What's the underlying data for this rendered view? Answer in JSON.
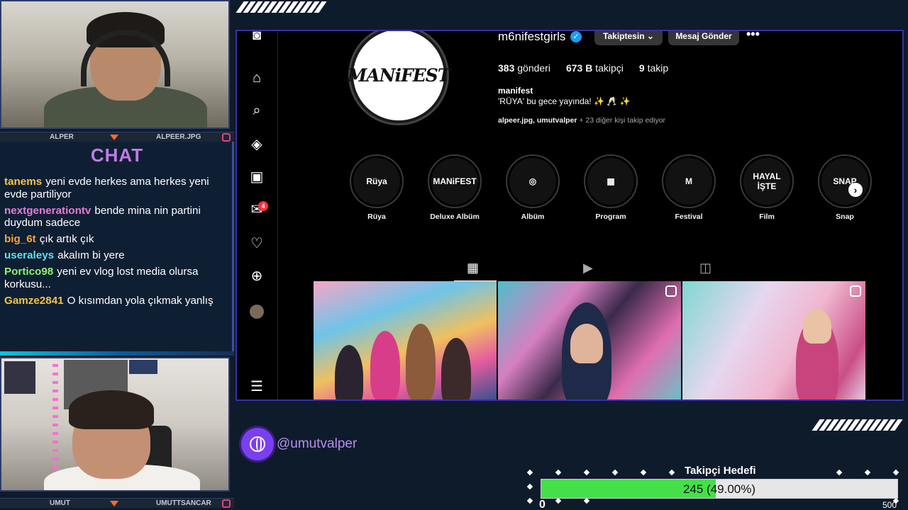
{
  "stream": {
    "cam_top": {
      "name_left": "ALPER",
      "name_right": "ALPEER.JPG"
    },
    "cam_bottom": {
      "name_left": "UMUT",
      "name_right": "UMUTTSANCAR"
    },
    "chat_title": "CHAT",
    "messages": [
      {
        "user": "tanems",
        "text": "yeni evde herkes ama herkes yeni evde partiliyor",
        "color": "#f6c34a"
      },
      {
        "user": "nextgenerationtv",
        "text": "bende mina nin partini duydum sadece",
        "color": "#e57bd8"
      },
      {
        "user": "big_6t",
        "text": "çık artık çık",
        "color": "#f6a13a"
      },
      {
        "user": "useraleys",
        "text": "akalım bi yere",
        "color": "#5ee0e8"
      },
      {
        "user": "Portico98",
        "text": "yeni ev vlog lost media olursa korkusu...",
        "color": "#8ef46a"
      },
      {
        "user": "Gamze2841",
        "text": "O kısımdan yola çıkmak yanlış",
        "color": "#f6c34a"
      }
    ],
    "handle": "@umutvalper",
    "goal": {
      "title": "Takipçi Hedefi",
      "current": 245,
      "max": 500,
      "min": 0,
      "label": "245 (49.00%)",
      "fraction": 0.49,
      "min_label": "0",
      "max_label": "500"
    }
  },
  "instagram": {
    "nav_icons": [
      "camera-icon",
      "home-icon",
      "search-icon",
      "explore-icon",
      "reels-icon",
      "messages-icon",
      "heart-icon",
      "create-icon",
      "profile-avatar",
      "menu-icon"
    ],
    "messages_badge": "4",
    "profile_pic_text": "MANiFEST",
    "username": "m6nifestgirls",
    "verified_mark": "✓",
    "follow_button": "Takiptesin ⌄",
    "message_button": "Mesaj Gönder",
    "more": "•••",
    "stats": {
      "posts_count": "383",
      "posts_label": "gönderi",
      "followers_count": "673 B",
      "followers_label": "takipçi",
      "following_count": "9",
      "following_label": "takip"
    },
    "bio_name": "manifest",
    "bio_text": "'RÜYA' bu gece yayında! ✨ 🥂 ✨",
    "followed_by_names": "alpeer.jpg, umutvalper",
    "followed_by_rest": " + 23 diğer kişi takip ediyor",
    "highlights": [
      {
        "label": "Rüya",
        "inner": "Rüya"
      },
      {
        "label": "Deluxe Albüm",
        "inner": "MANiFEST"
      },
      {
        "label": "Albüm",
        "inner": "◎"
      },
      {
        "label": "Program",
        "inner": "▦"
      },
      {
        "label": "Festival",
        "inner": "M"
      },
      {
        "label": "Film",
        "inner": "HAYAL İŞTE"
      },
      {
        "label": "Snap",
        "inner": "SNAP"
      }
    ],
    "tabs": [
      "grid-icon",
      "reels-tab-icon",
      "tagged-icon"
    ]
  }
}
